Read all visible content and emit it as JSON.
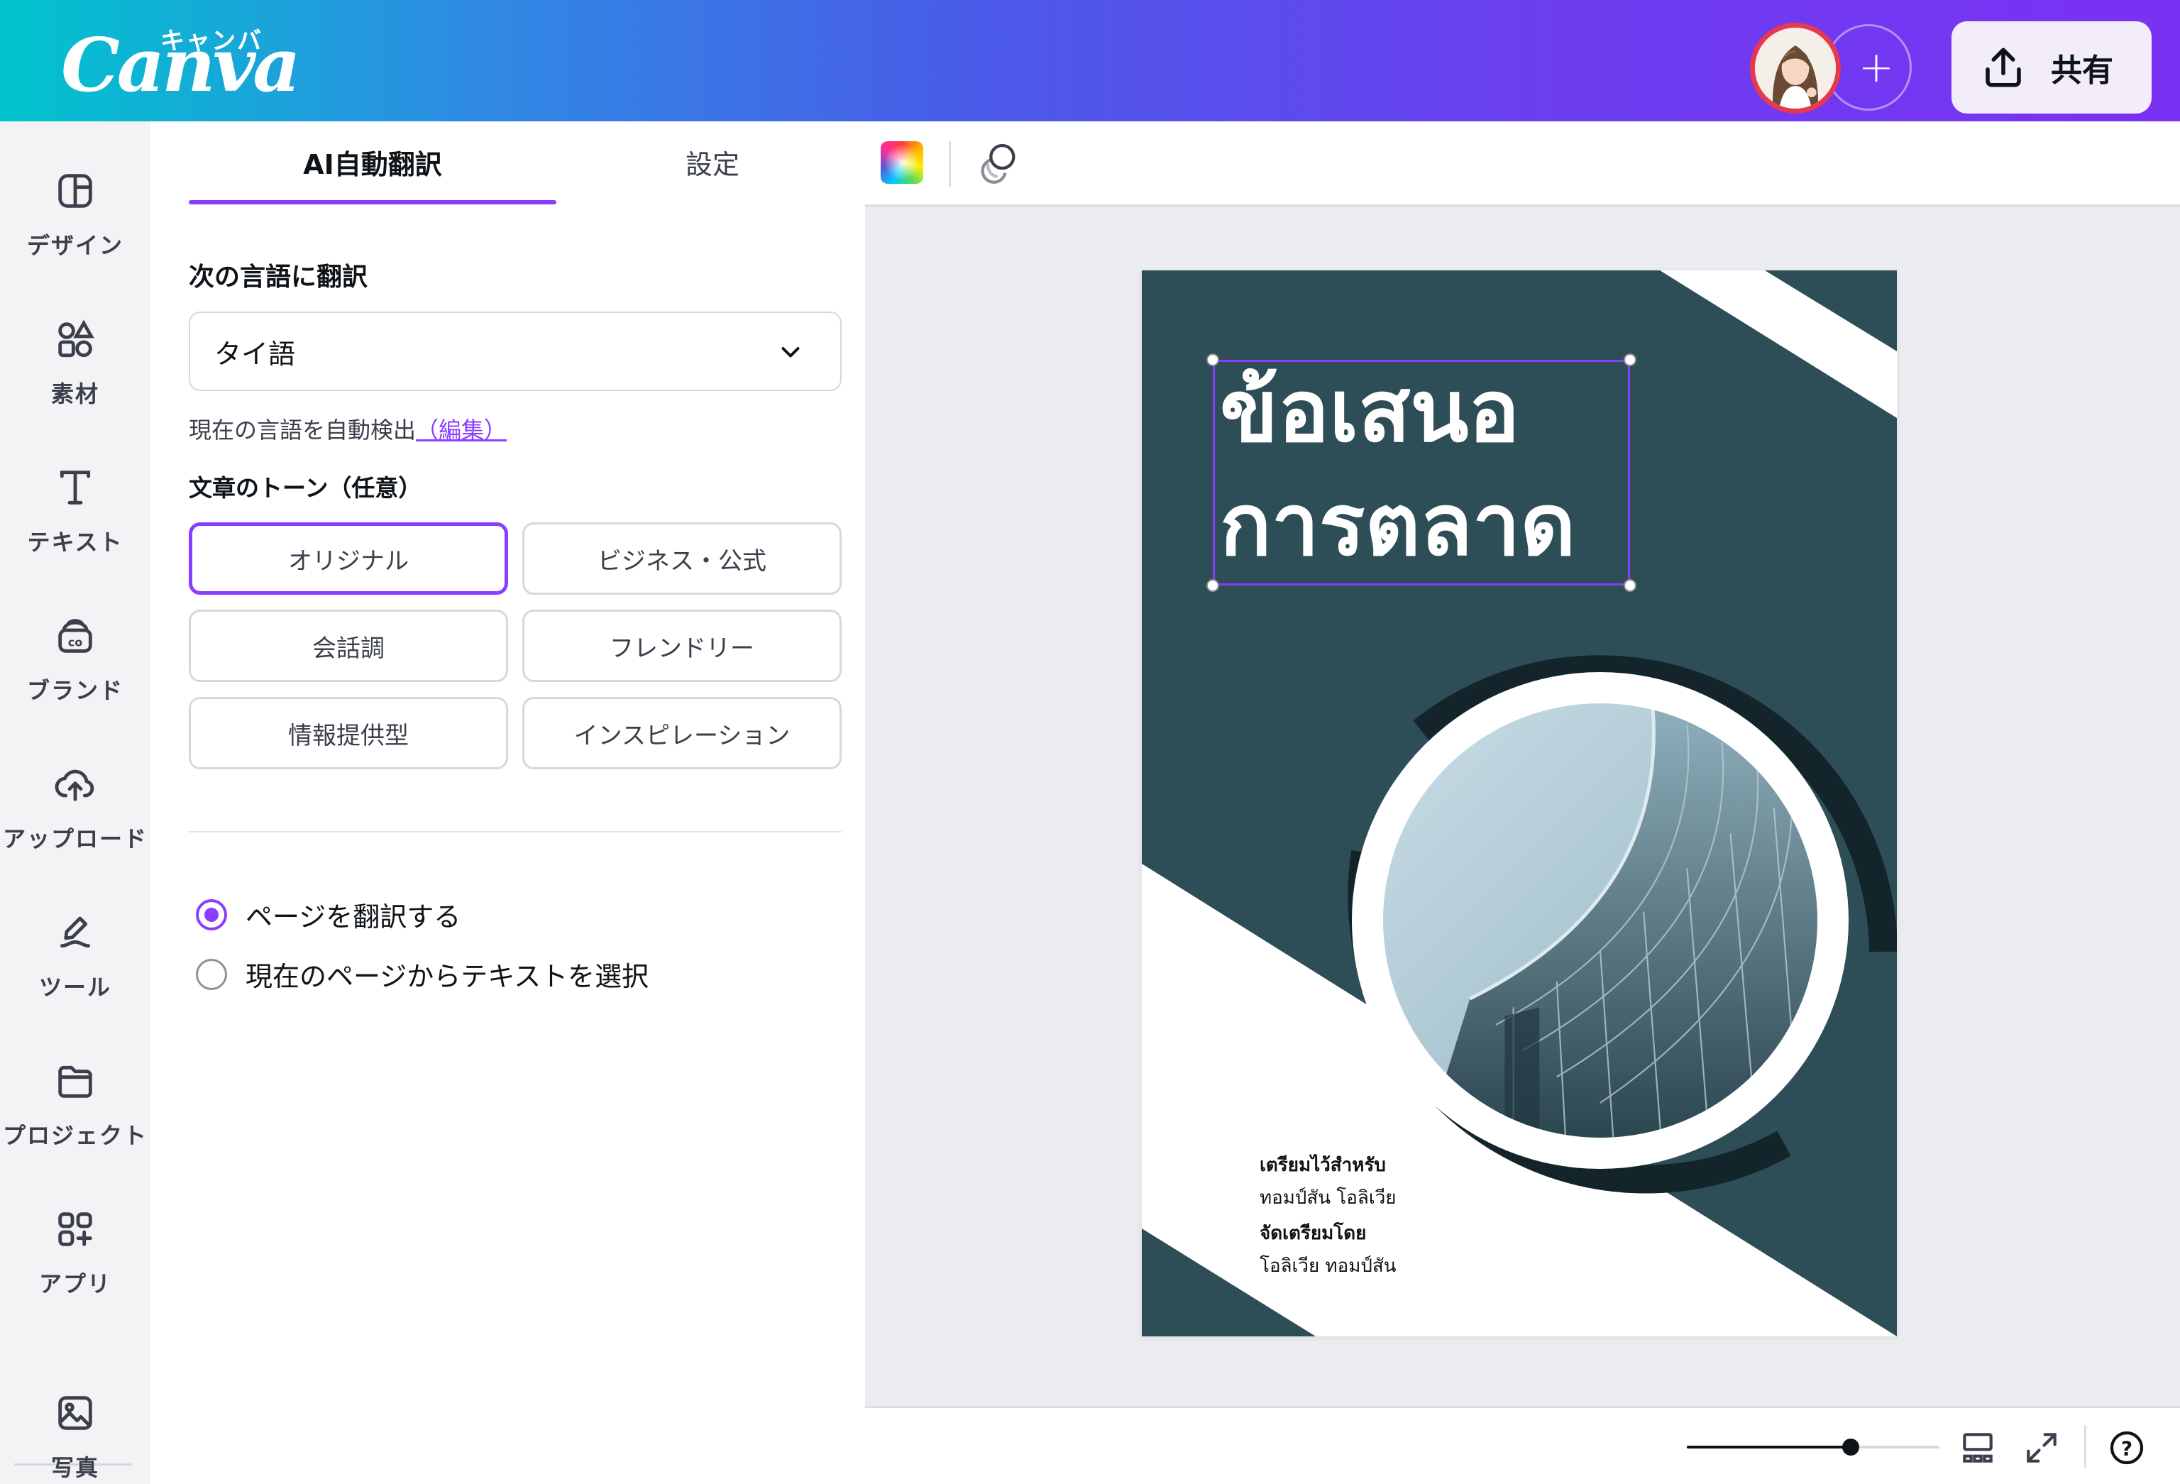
{
  "header": {
    "logo_text": "Canva",
    "logo_kana": "キャンバ",
    "add_label": "+",
    "share_label": "共有",
    "gradient": [
      "#00c4cc",
      "#7a31f2"
    ]
  },
  "rail": {
    "items": [
      {
        "label": "デザイン",
        "icon": "design-icon"
      },
      {
        "label": "素材",
        "icon": "elements-icon"
      },
      {
        "label": "テキスト",
        "icon": "text-icon"
      },
      {
        "label": "ブランド",
        "icon": "brand-icon"
      },
      {
        "label": "アップロード",
        "icon": "upload-icon"
      },
      {
        "label": "ツール",
        "icon": "tools-icon"
      },
      {
        "label": "プロジェクト",
        "icon": "folder-icon"
      },
      {
        "label": "アプリ",
        "icon": "apps-icon"
      },
      {
        "label": "写真",
        "icon": "photo-icon"
      }
    ]
  },
  "panel": {
    "tabs": [
      {
        "label": "AI自動翻訳"
      },
      {
        "label": "設定"
      }
    ],
    "translate_to_title": "次の言語に翻訳",
    "language": {
      "selected": "タイ語"
    },
    "detect_text": "現在の言語を自動検出",
    "edit_link": "（編集）",
    "tone_title": "文章のトーン（任意）",
    "tones": [
      {
        "label": "オリジナル"
      },
      {
        "label": "ビジネス・公式"
      },
      {
        "label": "会話調"
      },
      {
        "label": "フレンドリー"
      },
      {
        "label": "情報提供型"
      },
      {
        "label": "インスピレーション"
      }
    ],
    "scope_options": [
      {
        "label": "ページを翻訳する"
      },
      {
        "label": "現在のページからテキストを選択"
      }
    ],
    "accent": "#8b3dff"
  },
  "canvas": {
    "headline_line1": "ข้อเสนอ",
    "headline_line2": "การตลาด",
    "credits": [
      "เตรียมไว้สำหรับ",
      "ทอมป์สัน โอลิเวีย",
      "จัดเตรียมโดย",
      "โอลิเวีย ทอมป์สัน"
    ],
    "page_color": "#2d4d57"
  },
  "footer": {
    "zoom_level": 0.65,
    "help_label": "?"
  }
}
